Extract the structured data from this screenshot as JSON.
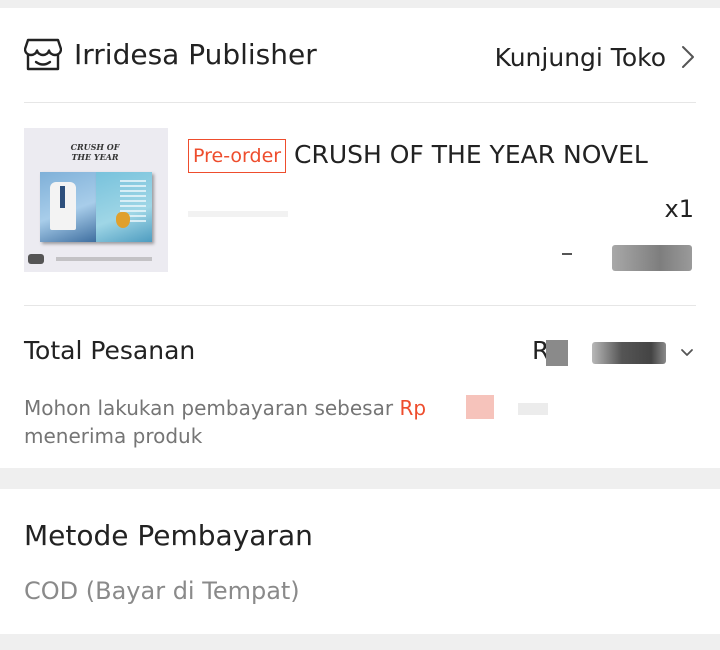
{
  "shop": {
    "name": "Irridesa Publisher",
    "visit_label": "Kunjungi Toko"
  },
  "product": {
    "badge": "Pre-order",
    "name": "CRUSH OF THE YEAR NOVEL",
    "quantity": "x1",
    "thumbnail_title": "CRUSH OF THE YEAR"
  },
  "order_total": {
    "label": "Total Pesanan",
    "value_prefix": "R"
  },
  "payment_note": {
    "text_before": "Mohon lakukan pembayaran sebesar ",
    "amount_prefix": "Rp",
    "text_after": "menerima produk"
  },
  "payment_method": {
    "title": "Metode Pembayaran",
    "value": "COD (Bayar di Tempat)"
  },
  "colors": {
    "accent": "#ee4d2d",
    "muted_text": "#757575",
    "background": "#efefef"
  },
  "icons": {
    "shop": "store-icon",
    "visit": "chevron-right-icon",
    "expand": "chevron-down-icon"
  }
}
